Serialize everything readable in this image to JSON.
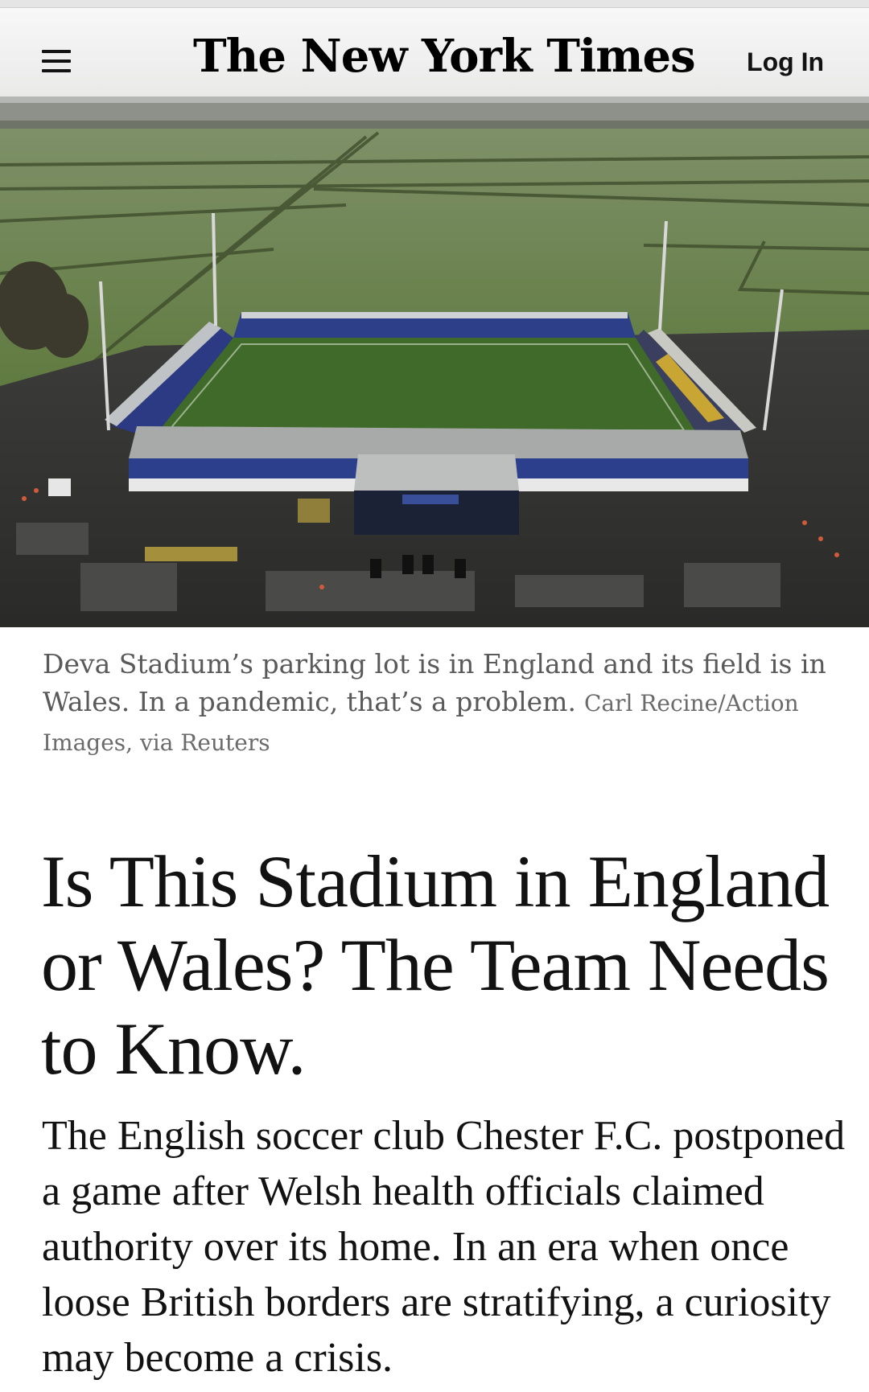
{
  "header": {
    "logo_text": "The New York Times",
    "login_label": "Log In",
    "menu_icon": "hamburger-menu-icon"
  },
  "hero": {
    "caption": "Deva Stadium’s parking lot is in England and its field is in Wales. In a pandemic, that’s a problem.",
    "credit": "Carl Recine/Action Images, via Reuters"
  },
  "article": {
    "headline": "Is This Stadium in England or Wales? The Team Needs to Know.",
    "summary": "The English soccer club Chester F.C. postponed a game after Welsh health officials claimed authority over its home. In an era when once loose British borders are stratifying, a curiosity may become a crisis."
  },
  "colors": {
    "text": "#121212",
    "caption": "#5a5a5a",
    "field_green": "#4f6b36",
    "seats_blue": "#2c3f8c"
  }
}
